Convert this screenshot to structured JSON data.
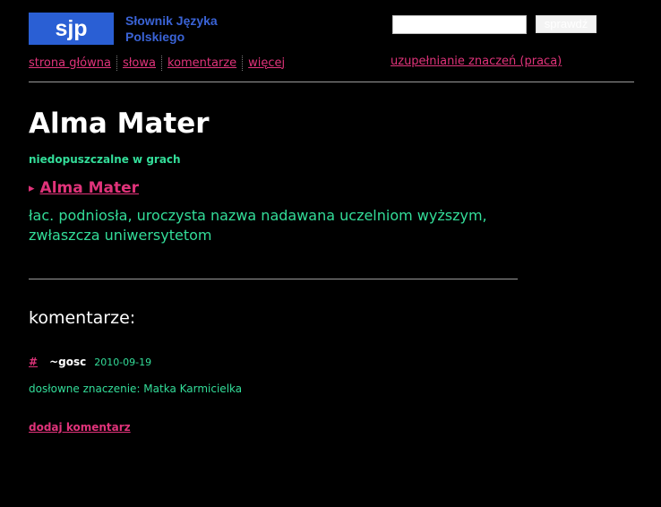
{
  "header": {
    "logo": "sjp",
    "site_name_line1": "Słownik Języka",
    "site_name_line2": "Polskiego",
    "search": {
      "value": "",
      "button_label": "sprawdź"
    }
  },
  "nav": {
    "items": [
      {
        "label": "strona główna"
      },
      {
        "label": "słowa"
      },
      {
        "label": "komentarze"
      },
      {
        "label": "więcej"
      }
    ],
    "right_link": "uzupełnianie znaczeń (praca)"
  },
  "entry": {
    "title": "Alma Mater",
    "note": "niedopuszczalne w grach",
    "meaning_marker": "▸",
    "meaning_title": "Alma Mater",
    "definition": "łac. podniosła, uroczysta nazwa nadawana uczelniom wyższym, zwłaszcza uniwersytetom"
  },
  "comments": {
    "heading": "komentarze:",
    "items": [
      {
        "anchor": "#",
        "author": "~gosc",
        "date": "2010-09-19",
        "text": "dosłowne znaczenie: Matka Karmicielka"
      }
    ],
    "add_label": "dodaj komentarz"
  },
  "colors": {
    "background": "#000000",
    "link": "#e0337a",
    "definition_text": "#33dd99",
    "logo_blue": "#2a5fd4"
  }
}
